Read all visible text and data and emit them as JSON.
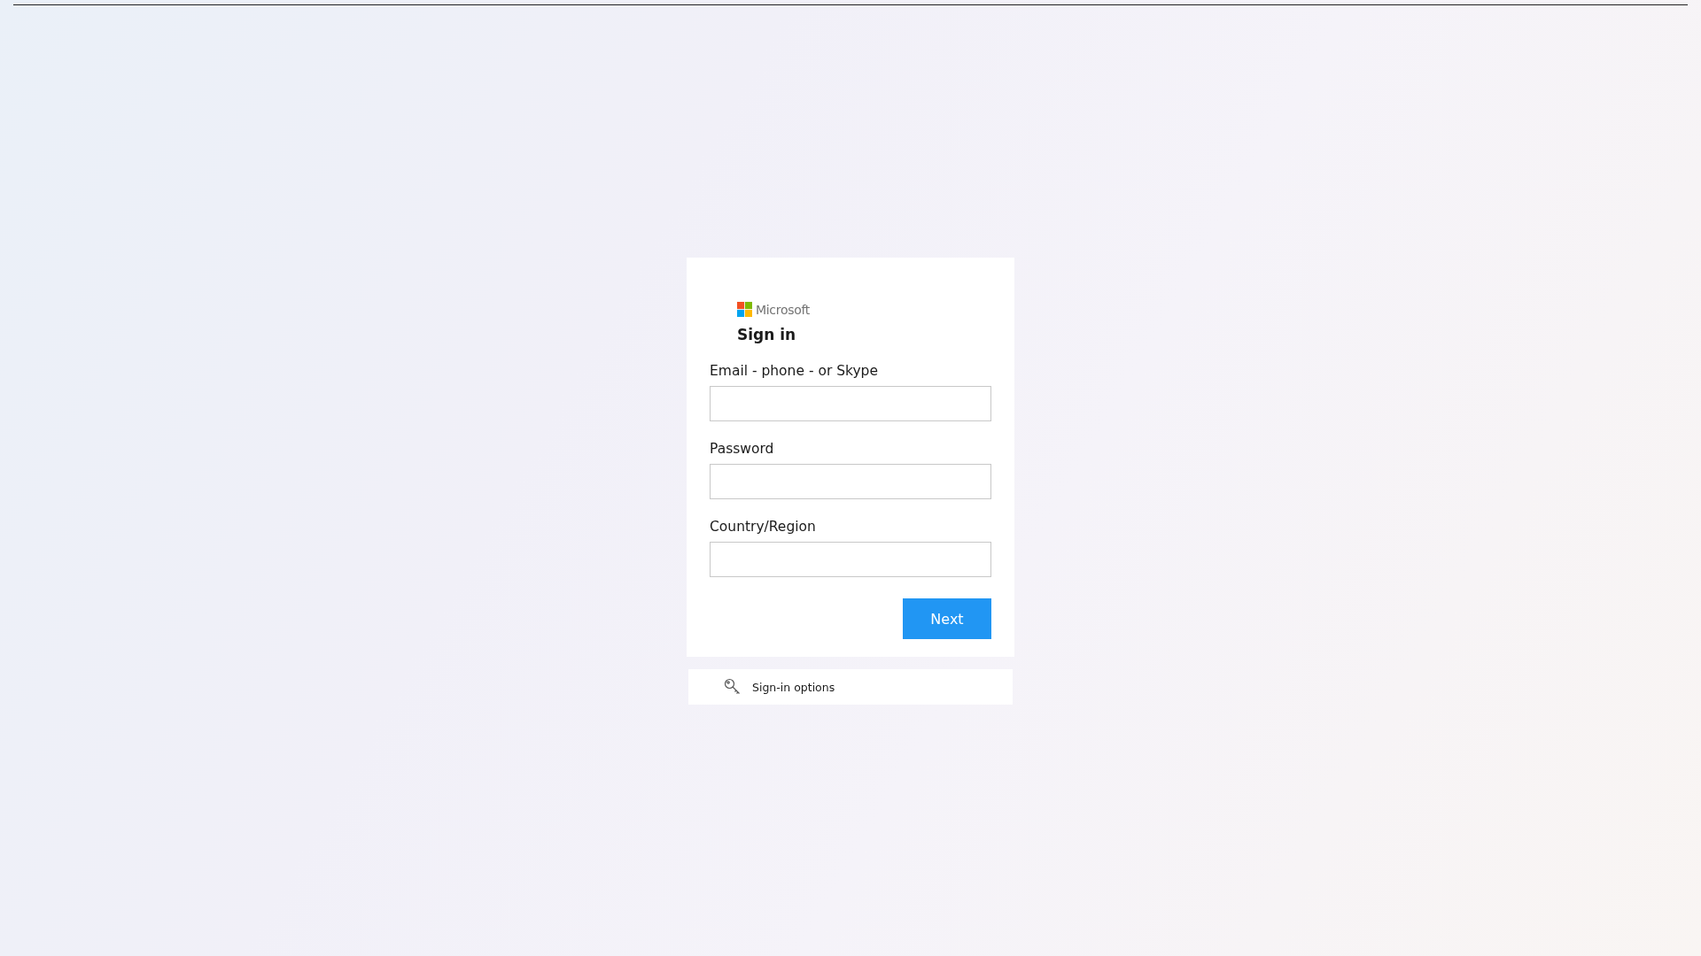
{
  "brand": {
    "name": "Microsoft"
  },
  "title": "Sign in",
  "fields": [
    {
      "label": "Email - phone - or Skype"
    },
    {
      "label": "Password"
    },
    {
      "label": "Country/Region"
    }
  ],
  "buttons": [
    {
      "label": "Next"
    }
  ],
  "options_link": {
    "label": "Sign-in options"
  }
}
